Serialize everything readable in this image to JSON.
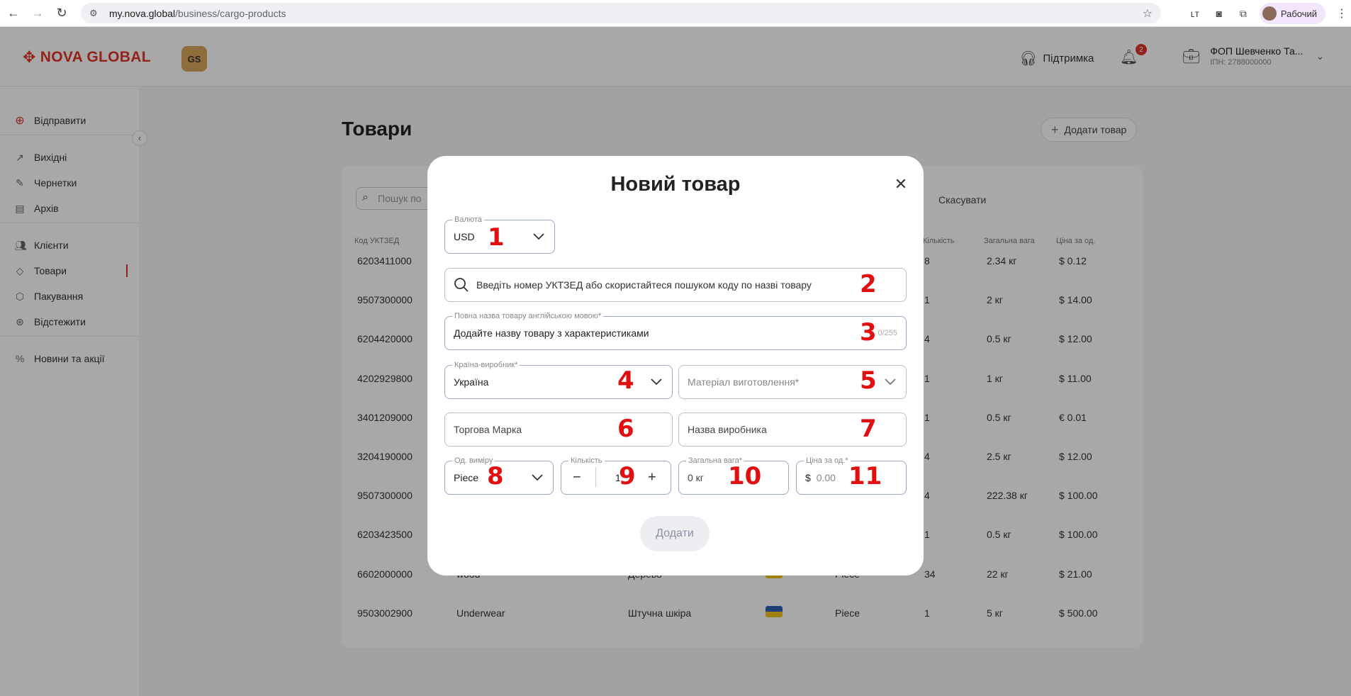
{
  "browser": {
    "url_host": "my.nova.global",
    "url_path": "/business/cargo-products",
    "profile_label": "Рабочий"
  },
  "header": {
    "logo": "NOVA GLOBAL",
    "gs_badge": "GS",
    "support": "Підтримка",
    "notifications_count": "2",
    "account_name": "ФОП Шевченко Та...",
    "account_inn": "ІПН: 2788000000"
  },
  "sidebar": {
    "send": "Відправити",
    "outgoing": "Вихідні",
    "drafts": "Чернетки",
    "archive": "Архів",
    "clients": "Клієнти",
    "products": "Товари",
    "packaging": "Пакування",
    "track": "Відстежити",
    "news": "Новини та акції"
  },
  "main": {
    "title": "Товари",
    "add_product": "Додати товар",
    "search_placeholder": "Пошук по",
    "cancel": "Скасувати",
    "columns": [
      "Код УКТЗЕД",
      "Кількість",
      "Загальна вага",
      "Ціна за од."
    ],
    "rows": [
      {
        "code": "6203411000",
        "qty": "8",
        "weight": "2.34 кг",
        "price": "$ 0.12"
      },
      {
        "code": "9507300000",
        "qty": "1",
        "weight": "2 кг",
        "price": "$ 14.00"
      },
      {
        "code": "6204420000",
        "qty": "4",
        "weight": "0.5 кг",
        "price": "$ 12.00"
      },
      {
        "code": "4202929800",
        "qty": "1",
        "weight": "1 кг",
        "price": "$ 11.00"
      },
      {
        "code": "3401209000",
        "qty": "1",
        "weight": "0.5 кг",
        "price": "€ 0.01"
      },
      {
        "code": "3204190000",
        "qty": "4",
        "weight": "2.5 кг",
        "price": "$ 12.00"
      },
      {
        "code": "9507300000",
        "qty": "4",
        "weight": "222.38 кг",
        "price": "$ 100.00"
      },
      {
        "code": "6203423500",
        "qty": "1",
        "weight": "0.5 кг",
        "price": "$ 100.00"
      },
      {
        "code": "6602000000",
        "name": "wood",
        "material": "Дерево",
        "unit": "Piece",
        "qty": "34",
        "weight": "22 кг",
        "price": "$ 21.00"
      },
      {
        "code": "9503002900",
        "name": "Underwear",
        "material": "Штучна шкіра",
        "unit": "Piece",
        "qty": "1",
        "weight": "5 кг",
        "price": "$ 500.00"
      }
    ]
  },
  "modal": {
    "title": "Новий товар",
    "currency_label": "Валюта",
    "currency_value": "USD",
    "uktzed_placeholder": "Введіть номер УКТЗЕД або скористайтеся пошуком коду по назві товару",
    "full_name_label": "Повна назва товару англійською мовою*",
    "full_name_placeholder": "Додайте назву товару з характеристиками",
    "full_name_counter": "0/255",
    "country_label": "Країна-виробник*",
    "country_value": "Україна",
    "material_placeholder": "Матеріал виготовлення*",
    "brand_placeholder": "Торгова Марка",
    "manufacturer_placeholder": "Назва виробника",
    "unit_label": "Од. виміру",
    "unit_value": "Piece",
    "qty_label": "Кількість",
    "qty_value": "1",
    "weight_label": "Загальна вага*",
    "weight_placeholder": "0 кг",
    "price_label": "Ціна за од.*",
    "price_symbol": "$",
    "price_placeholder": "0.00",
    "submit": "Додати"
  },
  "annotations": [
    "1",
    "2",
    "3",
    "4",
    "5",
    "6",
    "7",
    "8",
    "9",
    "10",
    "11"
  ]
}
